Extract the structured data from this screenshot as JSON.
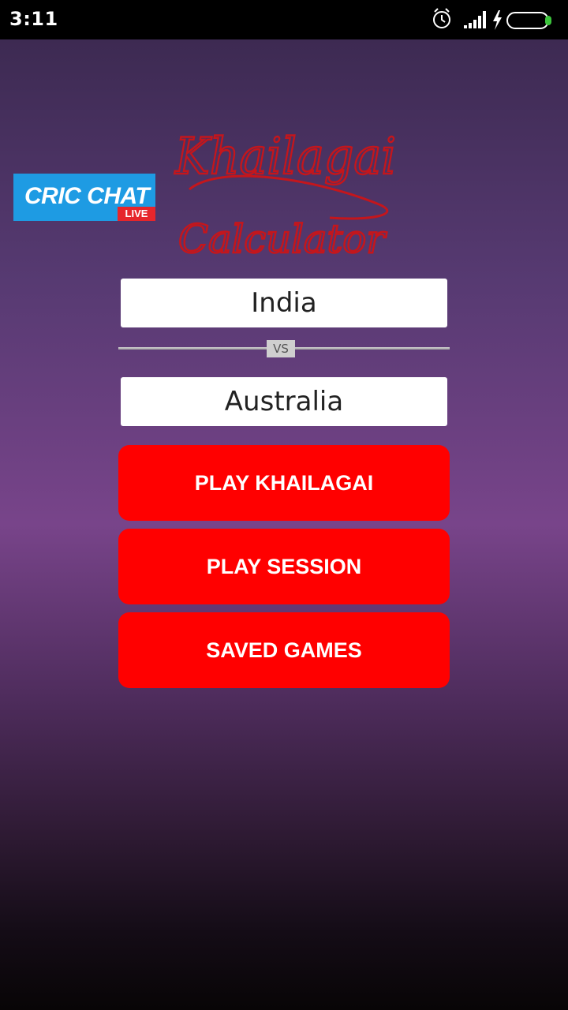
{
  "status_bar": {
    "time": "3:11",
    "icons": [
      "alarm-icon",
      "signal-icon",
      "charging-icon",
      "battery-icon"
    ],
    "battery_color": "#3cc43c"
  },
  "ads": {
    "cric_chat_title": "CRIC CHAT",
    "cric_chat_badge": "LIVE",
    "cric_chat_color": "#1e9be3",
    "badge_color": "#e6262b"
  },
  "brand_logo": {
    "line1": "Khailagai",
    "line2": "Calculator",
    "color": "#c4161c"
  },
  "match": {
    "team_a": "India",
    "vs_label": "VS",
    "team_b": "Australia"
  },
  "menu": {
    "play_khailagai": "PLAY KHAILAGAI",
    "play_session": "PLAY SESSION",
    "saved_games": "SAVED GAMES",
    "button_color": "#ff0000"
  }
}
